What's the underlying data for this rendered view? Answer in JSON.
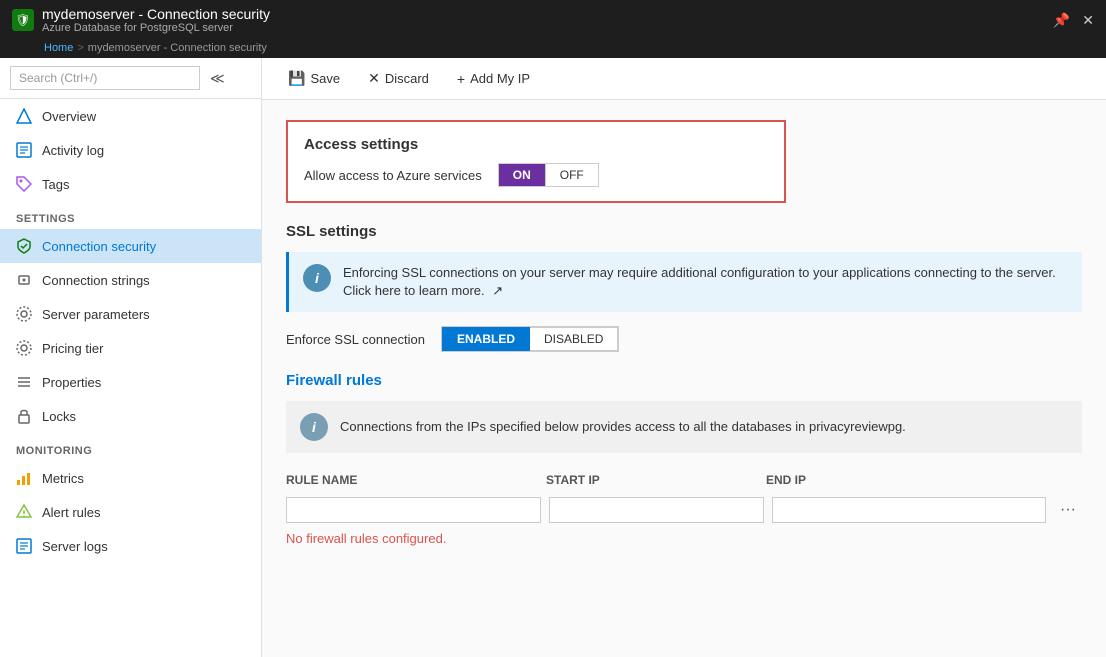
{
  "titlebar": {
    "main_title": "mydemoserver - Connection security",
    "subtitle": "Azure Database for PostgreSQL server",
    "pin_icon": "📌",
    "close_icon": "✕"
  },
  "breadcrumb": {
    "home": "Home",
    "separator": ">",
    "current": "mydemoserver - Connection security"
  },
  "sidebar": {
    "search_placeholder": "Search (Ctrl+/)",
    "nav_items": [
      {
        "id": "overview",
        "label": "Overview",
        "icon": "diamond"
      },
      {
        "id": "activity-log",
        "label": "Activity log",
        "icon": "list"
      },
      {
        "id": "tags",
        "label": "Tags",
        "icon": "tag"
      }
    ],
    "settings_header": "SETTINGS",
    "settings_items": [
      {
        "id": "connection-security",
        "label": "Connection security",
        "icon": "shield",
        "active": true
      },
      {
        "id": "connection-strings",
        "label": "Connection strings",
        "icon": "lock"
      },
      {
        "id": "server-parameters",
        "label": "Server parameters",
        "icon": "gear"
      },
      {
        "id": "pricing-tier",
        "label": "Pricing tier",
        "icon": "gear"
      },
      {
        "id": "properties",
        "label": "Properties",
        "icon": "bars"
      },
      {
        "id": "locks",
        "label": "Locks",
        "icon": "lock2"
      }
    ],
    "monitoring_header": "MONITORING",
    "monitoring_items": [
      {
        "id": "metrics",
        "label": "Metrics",
        "icon": "chart"
      },
      {
        "id": "alert-rules",
        "label": "Alert rules",
        "icon": "bell"
      },
      {
        "id": "server-logs",
        "label": "Server logs",
        "icon": "log"
      }
    ]
  },
  "toolbar": {
    "save_label": "Save",
    "discard_label": "Discard",
    "add_ip_label": "Add My IP",
    "save_icon": "💾",
    "discard_icon": "✕",
    "add_icon": "+"
  },
  "access_settings": {
    "title": "Access settings",
    "toggle_label": "Allow access to Azure services",
    "on_label": "ON",
    "off_label": "OFF"
  },
  "ssl_settings": {
    "title": "SSL settings",
    "info_text": "Enforcing SSL connections on your server may require additional configuration to your applications connecting to the server. Click here to learn more.",
    "enforce_label": "Enforce SSL connection",
    "enabled_label": "ENABLED",
    "disabled_label": "DISABLED"
  },
  "firewall_rules": {
    "title": "Firewall rules",
    "info_text": "Connections from the IPs specified below provides access to all the databases in privacyreviewpg.",
    "col_rule": "RULE NAME",
    "col_start": "START IP",
    "col_end": "END IP",
    "no_rules_text": "No firewall rules configured."
  }
}
